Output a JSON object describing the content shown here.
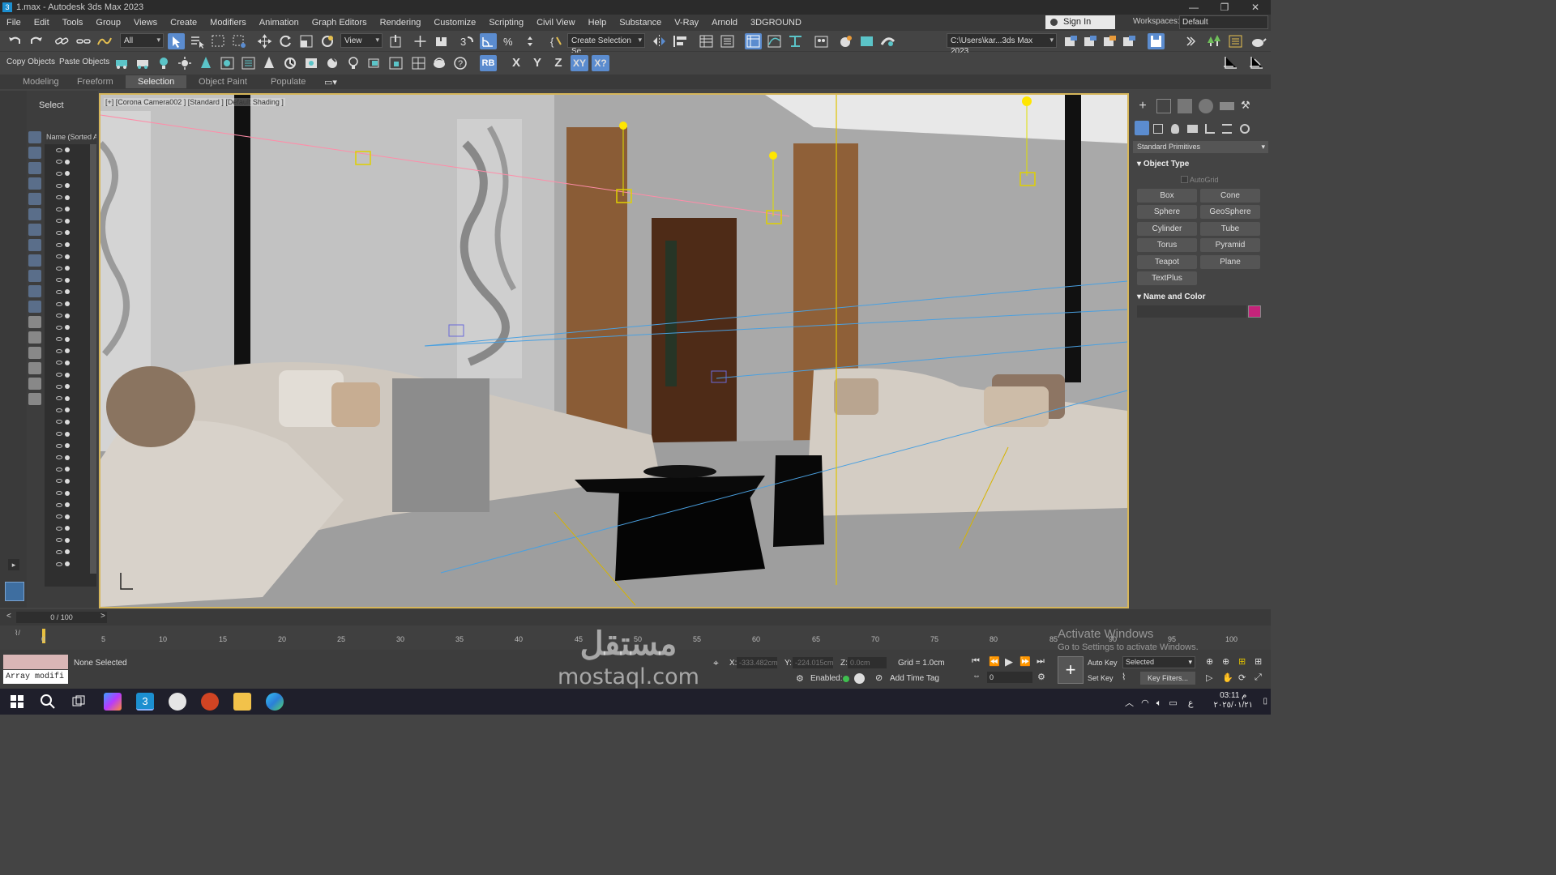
{
  "window": {
    "title": "1.max - Autodesk 3ds Max 2023",
    "controls": [
      "—",
      "❐",
      "✕"
    ]
  },
  "menu": [
    "File",
    "Edit",
    "Tools",
    "Group",
    "Views",
    "Create",
    "Modifiers",
    "Animation",
    "Graph Editors",
    "Rendering",
    "Customize",
    "Scripting",
    "Civil View",
    "Help",
    "Substance",
    "V-Ray",
    "Arnold",
    "3DGROUND"
  ],
  "account": {
    "sign_in": "Sign In",
    "workspaces_label": "Workspaces:",
    "workspace": "Default"
  },
  "toolbar": {
    "filter": "All",
    "ref_coord": "View",
    "selection_set": "Create Selection Se",
    "project_path": "C:\\Users\\kar...3ds Max 2023",
    "copy_objects": "Copy Objects",
    "paste_objects": "Paste Objects",
    "axis_x": "X",
    "axis_y": "Y",
    "axis_z": "Z",
    "axis_xy": "XY",
    "axis_xyq": "X?",
    "rb": "RB"
  },
  "ribbon": [
    "Modeling",
    "Freeform",
    "Selection",
    "Object Paint",
    "Populate"
  ],
  "scene_explorer": {
    "title": "Select",
    "column": "Name (Sorted A"
  },
  "viewport": {
    "label": "[+] [Corona Camera002 ] [Standard ] [Default Shading ]"
  },
  "command_panel": {
    "category": "Standard Primitives",
    "object_type": "Object Type",
    "autogrid": "AutoGrid",
    "buttons": [
      "Box",
      "Cone",
      "Sphere",
      "GeoSphere",
      "Cylinder",
      "Tube",
      "Torus",
      "Pyramid",
      "Teapot",
      "Plane",
      "TextPlus"
    ],
    "name_and_color": "Name and Color",
    "object_color": "#c4237a"
  },
  "timeline": {
    "frame": "0 / 100",
    "ticks": [
      "0",
      "5",
      "10",
      "15",
      "20",
      "25",
      "30",
      "35",
      "40",
      "45",
      "50",
      "55",
      "60",
      "65",
      "70",
      "75",
      "80",
      "85",
      "90",
      "95",
      "100"
    ]
  },
  "status": {
    "script_label": "Array modifi",
    "selection": "None Selected",
    "x_label": "X:",
    "x_val": "-333.482cm",
    "y_label": "Y:",
    "y_val": "-224.015cm",
    "z_label": "Z:",
    "z_val": "0.0cm",
    "grid": "Grid = 1.0cm",
    "enabled": "Enabled:",
    "add_time_tag": "Add Time Tag",
    "auto_key": "Auto Key",
    "set_key": "Set Key",
    "key_mode": "Selected",
    "key_filters": "Key Filters...",
    "current_frame": "0"
  },
  "overlay": {
    "activate_title": "Activate Windows",
    "activate_sub": "Go to Settings to activate Windows.",
    "watermark_ar": "مستقل",
    "watermark_url": "mostaql.com"
  },
  "taskbar": {
    "time": "03:11 م",
    "date": "٢٠٢٥/٠١/٢١",
    "lang": "ع"
  }
}
